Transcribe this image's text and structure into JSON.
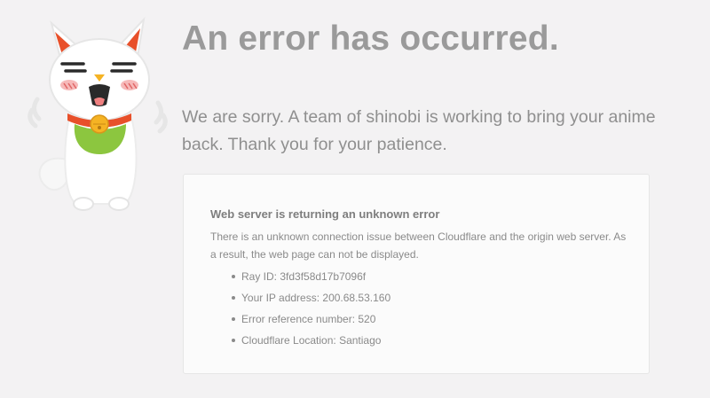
{
  "page": {
    "title": "An error has occurred.",
    "apology": "We are sorry. A team of shinobi is working to bring your anime back. Thank you for your patience.",
    "mascot": "lucky-cat-mascot",
    "colors": {
      "background": "#f3f2f3",
      "text": "#9a9a9a",
      "mascot_collar": "#e8502a",
      "mascot_bib": "#8cc63f",
      "mascot_bell": "#f5b324"
    }
  },
  "error_card": {
    "heading": "Web server is returning an unknown error",
    "description": "There is an unknown connection issue between Cloudflare and the origin web server. As a result, the web page can not be displayed.",
    "details": [
      "Ray ID: 3fd3f58d17b7096f",
      "Your IP address: 200.68.53.160",
      "Error reference number: 520",
      "Cloudflare Location: Santiago"
    ]
  }
}
